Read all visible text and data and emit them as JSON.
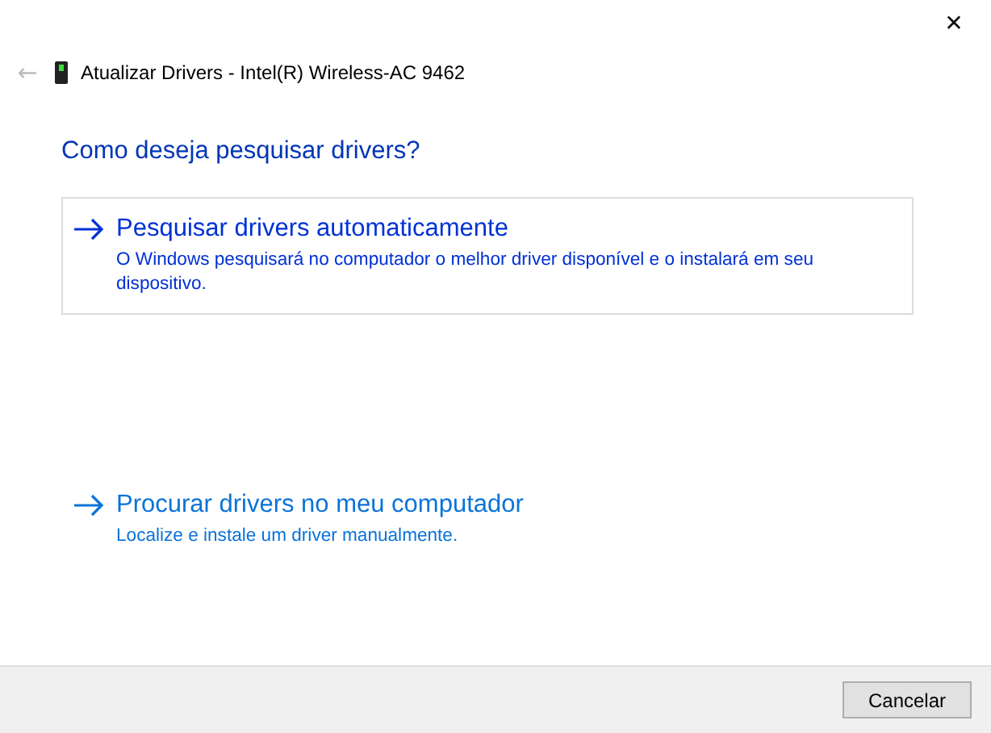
{
  "window": {
    "close": "✕",
    "back": "←",
    "title": "Atualizar Drivers - Intel(R) Wireless-AC 9462"
  },
  "heading": "Como deseja pesquisar drivers?",
  "options": [
    {
      "title": "Pesquisar drivers automaticamente",
      "description": "O Windows pesquisará no computador o melhor driver disponível e o instalará em seu dispositivo.",
      "hovered": true
    },
    {
      "title": "Procurar drivers no meu computador",
      "description": "Localize e instale um driver manualmente.",
      "hovered": false
    }
  ],
  "buttons": [
    "Cancelar"
  ]
}
